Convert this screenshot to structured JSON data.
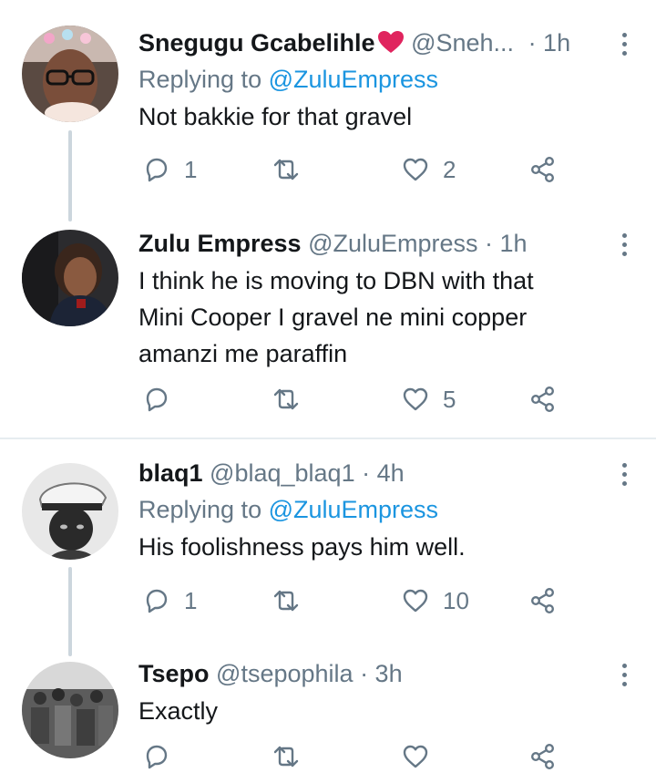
{
  "tweets": [
    {
      "name": "Snegugu Gcabelihle",
      "handle": "@Sneh...",
      "time": "· 1h",
      "replying_prefix": "Replying to ",
      "replying_to": "@ZuluEmpress",
      "text": "Not bakkie for that gravel",
      "reply_count": "1",
      "retweet_count": "",
      "like_count": "2"
    },
    {
      "name": "Zulu Empress",
      "handle": "@ZuluEmpress",
      "time": "· 1h",
      "text_lines": [
        "I think he is moving to DBN with that",
        "Mini Cooper I gravel ne mini copper",
        "amanzi me paraffin"
      ],
      "reply_count": "",
      "retweet_count": "",
      "like_count": "5"
    },
    {
      "name": "blaq1",
      "handle": "@blaq_blaq1",
      "time": "· 4h",
      "replying_prefix": "Replying to ",
      "replying_to": "@ZuluEmpress",
      "text": "His foolishness pays him well.",
      "reply_count": "1",
      "retweet_count": "",
      "like_count": "10"
    },
    {
      "name": "Tsepo",
      "handle": "@tsepophila",
      "time": "· 3h",
      "text": "Exactly",
      "reply_count": "",
      "retweet_count": "",
      "like_count": ""
    }
  ],
  "icons": {
    "reply": "reply-icon",
    "retweet": "retweet-icon",
    "like": "heart-icon",
    "share": "share-icon",
    "more": "more-vertical-icon",
    "verified_heart": "red-heart-emoji"
  },
  "colors": {
    "text": "#14171a",
    "secondary": "#657786",
    "link": "#1b95e0",
    "thread_line": "#ccd6dd",
    "heart_emoji": "#e0245e"
  }
}
